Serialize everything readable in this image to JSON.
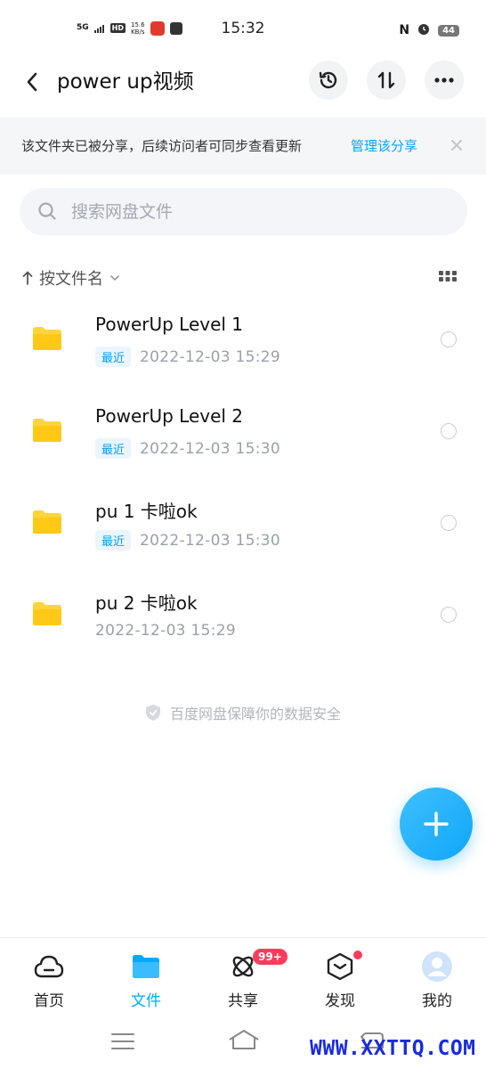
{
  "status_bar": {
    "signal": "5G",
    "hd": "HD",
    "speed_value": "15.6",
    "speed_unit": "KB/s",
    "time": "15:32",
    "nfc": "N",
    "battery": "44"
  },
  "header": {
    "title": "power up视频"
  },
  "banner": {
    "text": "该文件夹已被分享，后续访问者可同步查看更新",
    "link": "管理该分享"
  },
  "search": {
    "placeholder": "搜索网盘文件"
  },
  "sort": {
    "label": "按文件名"
  },
  "files": [
    {
      "name": "PowerUp Level 1",
      "tag": "最近",
      "date": "2022-12-03  15:29"
    },
    {
      "name": "PowerUp Level 2",
      "tag": "最近",
      "date": "2022-12-03  15:30"
    },
    {
      "name": "pu 1 卡啦ok",
      "tag": "最近",
      "date": "2022-12-03  15:30"
    },
    {
      "name": "pu 2 卡啦ok",
      "tag": "",
      "date": "2022-12-03  15:29"
    }
  ],
  "safe_note": "百度网盘保障你的数据安全",
  "nav": {
    "home": "首页",
    "files": "文件",
    "share": "共享",
    "share_badge": "99+",
    "discover": "发现",
    "me": "我的"
  },
  "watermark": "WWW.XXTTQ.COM",
  "colors": {
    "accent": "#06a7ff",
    "folder": "#ffd53a",
    "badge": "#ff3b5c"
  }
}
